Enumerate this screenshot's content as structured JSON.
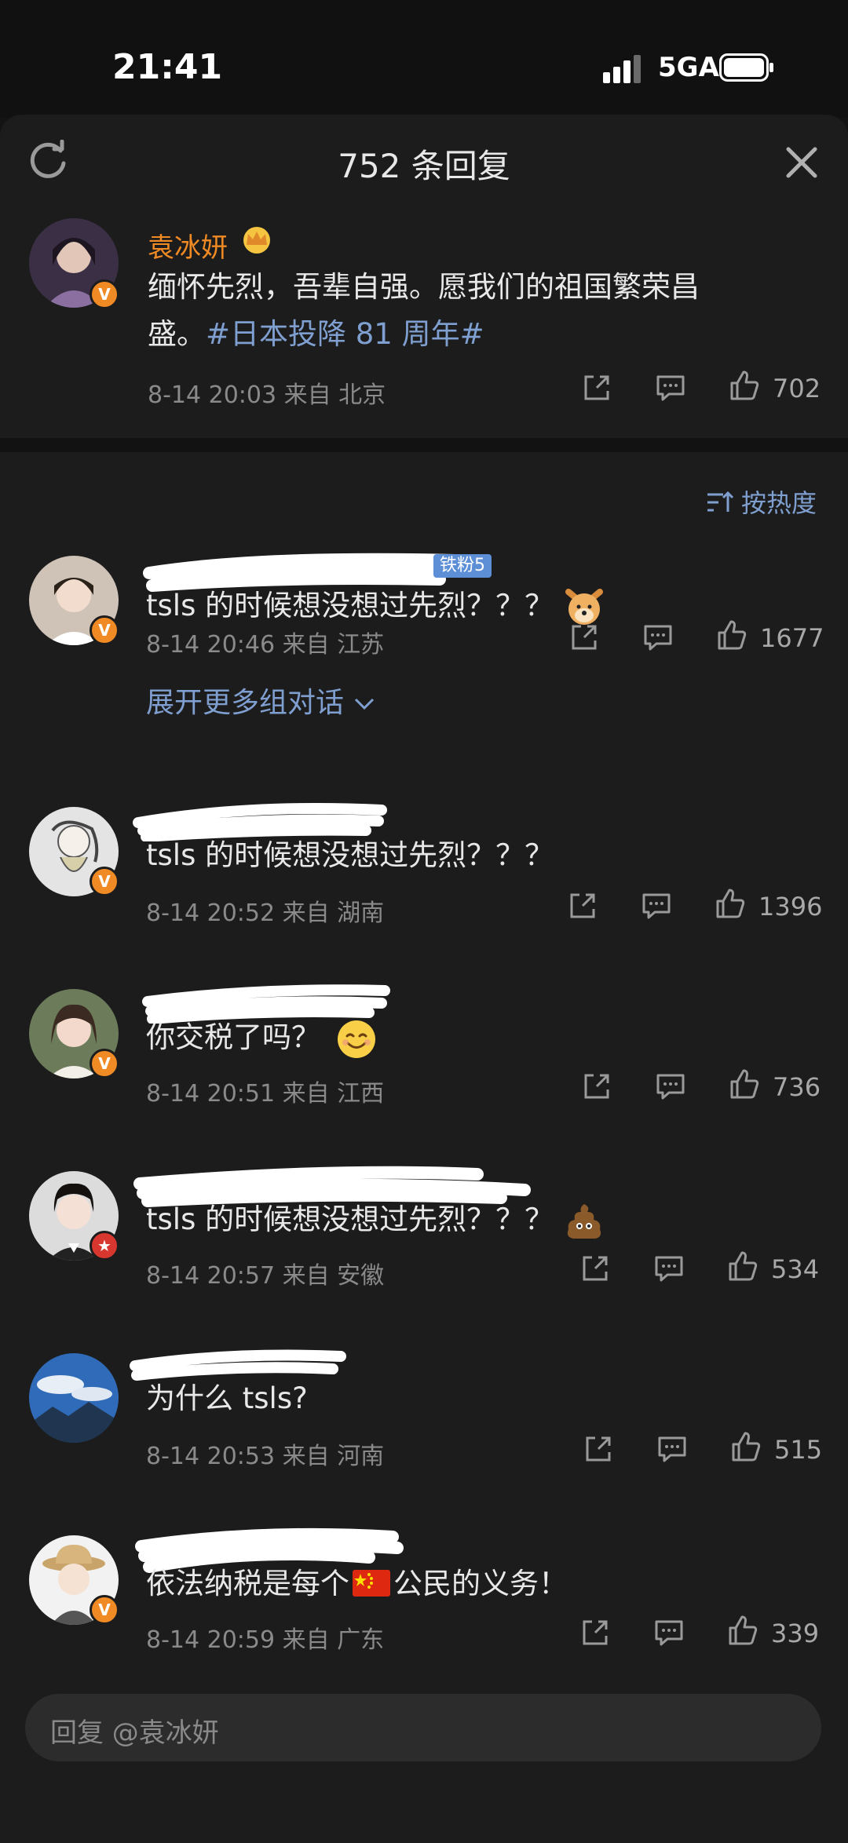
{
  "status_bar": {
    "time": "21:41",
    "network": "5GA"
  },
  "sheet": {
    "title": "752 条回复"
  },
  "root_comment": {
    "author": "袁冰妍",
    "text_line1": "缅怀先烈，吾辈自强。愿我们的祖国繁荣昌",
    "text_line2_prefix": "盛。",
    "hashtag": "#日本投降 81 周年#",
    "meta": "8-14 20:03  来自 北京",
    "likes": "702"
  },
  "sort": {
    "label": "按热度"
  },
  "comments": [
    {
      "text": "tsls 的时候想没想过先烈？？？",
      "meta": "8-14 20:46  来自 江苏",
      "likes": "1677",
      "badge": "铁粉5",
      "expand": "展开更多组对话"
    },
    {
      "text": "tsls 的时候想没想过先烈？？？",
      "meta": "8-14 20:52  来自 湖南",
      "likes": "1396"
    },
    {
      "text": "你交税了吗？",
      "meta": "8-14 20:51  来自 江西",
      "likes": "736"
    },
    {
      "text": "tsls 的时候想没想过先烈？？？",
      "meta": "8-14 20:57  来自 安徽",
      "likes": "534"
    },
    {
      "text": "为什么 tsls?",
      "meta": "8-14 20:53  来自 河南",
      "likes": "515"
    },
    {
      "text_prefix": "依法纳税是每个",
      "text_suffix": "公民的义务！",
      "meta": "8-14 20:59  来自 广东",
      "likes": "339"
    }
  ],
  "reply_bar": {
    "placeholder": "回复 @袁冰妍"
  },
  "colors": {
    "accent_orange": "#f08a24",
    "link_blue": "#7f9fd0",
    "background": "#1c1c1c"
  },
  "icons": [
    "refresh-icon",
    "close-icon",
    "crown-icon",
    "share-icon",
    "comment-icon",
    "like-icon",
    "sort-icon",
    "chevron-down-icon",
    "v-badge-icon"
  ]
}
